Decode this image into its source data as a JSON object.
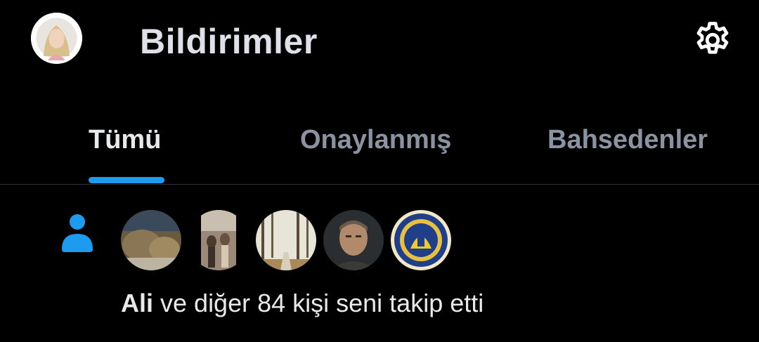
{
  "header": {
    "title": "Bildirimler",
    "avatar_icon": "user-avatar",
    "settings_icon": "gear-icon"
  },
  "tabs": [
    {
      "label": "Tümü",
      "active": true
    },
    {
      "label": "Onaylanmış",
      "active": false
    },
    {
      "label": "Bahsedenler",
      "active": false
    }
  ],
  "colors": {
    "background": "#000000",
    "accent": "#1d9bf0",
    "text_primary": "#e7e9ea",
    "text_secondary": "#8a93a1"
  },
  "notification": {
    "icon": "person-icon",
    "actor": "Ali",
    "text": " ve diğer 84 kişi seni takip etti",
    "avatars": [
      "follower-avatar-1",
      "follower-avatar-2",
      "follower-avatar-3",
      "follower-avatar-4",
      "follower-avatar-5"
    ]
  }
}
